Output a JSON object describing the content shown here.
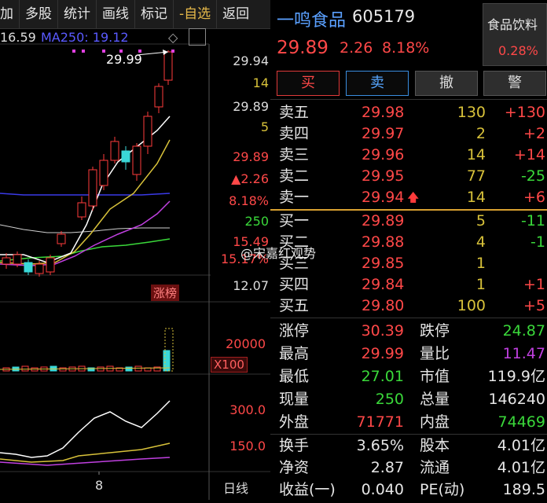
{
  "toolbar": {
    "items": [
      "加",
      "多股",
      "统计",
      "画线",
      "标记",
      "-自选",
      "返回"
    ]
  },
  "chart": {
    "ma_label_left": "16.59",
    "ma250_label": "MA250: 19.12",
    "peak_label": "29.99",
    "axis_right": [
      "29.94",
      "14",
      "29.89",
      "5",
      "29.89",
      "▲2.26",
      "8.18%",
      "250",
      "15.49",
      "15.17%",
      "12.07"
    ],
    "limit_up_tag": "涨榜",
    "vol_axis": "20000",
    "vol_unit": "X100",
    "ind_axis_top": "300.0",
    "ind_axis_bottom": "150.0",
    "x_tick": "8",
    "period": "日线",
    "colors": {
      "up": "#ff3b3b",
      "down": "#3ad8d8",
      "ma_white": "#ffffff",
      "ma_yellow": "#d8c23a",
      "ma_purple": "#c040e0",
      "ma_green": "#3ad83a",
      "ma250": "#3a3ae8"
    }
  },
  "quote": {
    "name": "一鸣食品",
    "code": "605179",
    "price": "29.89",
    "change": "2.26",
    "change_pct": "8.18%",
    "sector_name": "食品饮料",
    "sector_pct": "0.28%"
  },
  "buttons": {
    "buy": "买",
    "sell": "卖",
    "cancel": "撤",
    "alert": "警"
  },
  "order_book": {
    "asks": [
      {
        "label": "卖五",
        "price": "29.98",
        "vol": "130",
        "chg": "+130"
      },
      {
        "label": "卖四",
        "price": "29.97",
        "vol": "2",
        "chg": "+2"
      },
      {
        "label": "卖三",
        "price": "29.96",
        "vol": "14",
        "chg": "+14"
      },
      {
        "label": "卖二",
        "price": "29.95",
        "vol": "77",
        "chg": "-25"
      },
      {
        "label": "卖一",
        "price": "29.94",
        "vol": "14",
        "chg": "+6"
      }
    ],
    "bids": [
      {
        "label": "买一",
        "price": "29.89",
        "vol": "5",
        "chg": "-11"
      },
      {
        "label": "买二",
        "price": "29.88",
        "vol": "4",
        "chg": "-1"
      },
      {
        "label": "买三",
        "price": "29.85",
        "vol": "1",
        "chg": ""
      },
      {
        "label": "买四",
        "price": "29.84",
        "vol": "1",
        "chg": "+1"
      },
      {
        "label": "买五",
        "price": "29.80",
        "vol": "100",
        "chg": "+5"
      }
    ]
  },
  "stats": {
    "rows1": [
      {
        "l1": "涨停",
        "v1": "30.39",
        "l2": "跌停",
        "v2": "24.87"
      },
      {
        "l1": "最高",
        "v1": "29.99",
        "l2": "量比",
        "v2": "11.47"
      },
      {
        "l1": "最低",
        "v1": "27.01",
        "l2": "市值",
        "v2": "119.9亿"
      },
      {
        "l1": "现量",
        "v1": "250",
        "l2": "总量",
        "v2": "146240"
      },
      {
        "l1": "外盘",
        "v1": "71771",
        "l2": "内盘",
        "v2": "74469"
      }
    ],
    "rows2": [
      {
        "l1": "换手",
        "v1": "3.65%",
        "l2": "股本",
        "v2": "4.01亿"
      },
      {
        "l1": "净资",
        "v1": "2.87",
        "l2": "流通",
        "v2": "4.01亿"
      },
      {
        "l1": "收益(一)",
        "v1": "0.040",
        "l2": "PE(动)",
        "v2": "189.5"
      }
    ]
  },
  "watermark": "@宋嘉红观势"
}
